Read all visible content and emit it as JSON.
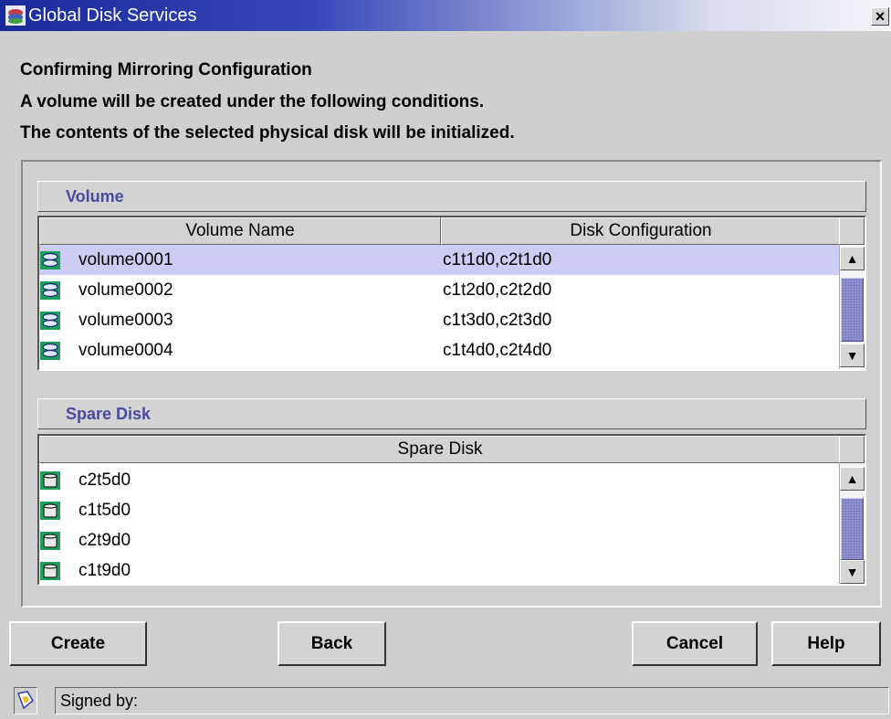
{
  "window": {
    "title": "Global Disk Services",
    "close_label": "×"
  },
  "header": {
    "line1": "Confirming Mirroring Configuration",
    "line2": "A volume will be created under the following conditions.",
    "line3": "The contents of the selected physical disk will be initialized."
  },
  "volume_section": {
    "title": "Volume",
    "columns": [
      "Volume Name",
      "Disk Configuration"
    ],
    "rows": [
      {
        "name": "volume0001",
        "config": "c1t1d0,c2t1d0",
        "selected": true
      },
      {
        "name": "volume0002",
        "config": "c1t2d0,c2t2d0",
        "selected": false
      },
      {
        "name": "volume0003",
        "config": "c1t3d0,c2t3d0",
        "selected": false
      },
      {
        "name": "volume0004",
        "config": "c1t4d0,c2t4d0",
        "selected": false
      }
    ],
    "row_icon": "volume-icon"
  },
  "spare_section": {
    "title": "Spare Disk",
    "columns": [
      "Spare Disk"
    ],
    "rows": [
      "c2t5d0",
      "c1t5d0",
      "c2t9d0",
      "c1t9d0"
    ],
    "row_icon": "disk-icon"
  },
  "buttons": {
    "create": "Create",
    "back": "Back",
    "cancel": "Cancel",
    "help": "Help"
  },
  "status": {
    "text": "Signed by:",
    "icon": "certificate-icon"
  },
  "colors": {
    "title_start": "#1a2a9a",
    "selection": "#ccccf4",
    "section_title": "#4a4aa0",
    "icon_bg": "#1aa05a"
  }
}
